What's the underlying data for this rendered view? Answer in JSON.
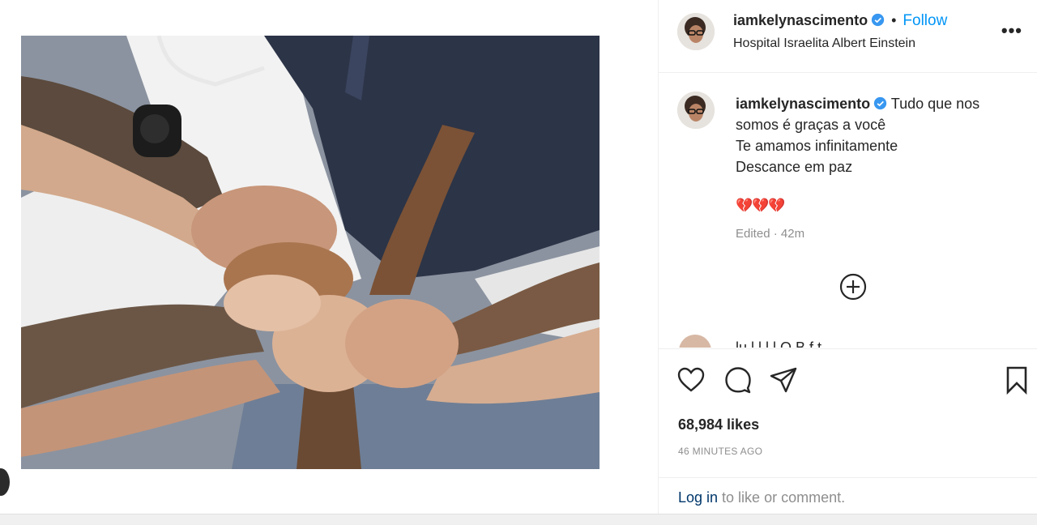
{
  "post": {
    "username": "iamkelynascimento",
    "follow_label": "Follow",
    "separator": "•",
    "location": "Hospital Israelita Albert Einstein",
    "more_label": "•••"
  },
  "caption": {
    "username": "iamkelynascimento",
    "lines": [
      "Tudo que nos",
      "somos é graças a você",
      "Te amamos infinitamente",
      "Descance em paz"
    ],
    "emoji": "💔💔💔",
    "edited": "Edited",
    "time": "42m"
  },
  "partial_comment": {
    "text": "lu l  l l l  O  B       f  t"
  },
  "engagement": {
    "likes": "68,984 likes",
    "time_ago": "46 MINUTES AGO"
  },
  "login": {
    "link": "Log in",
    "rest": " to like or comment."
  },
  "icons": {
    "like": "heart-icon",
    "comment": "comment-icon",
    "share": "share-icon",
    "save": "bookmark-icon",
    "load_more": "plus-circle-icon",
    "verified": "verified-badge-icon"
  },
  "colors": {
    "follow": "#0095f6",
    "verified": "#3897f0",
    "secondary_text": "#8e8e8e",
    "link": "#00376b"
  }
}
